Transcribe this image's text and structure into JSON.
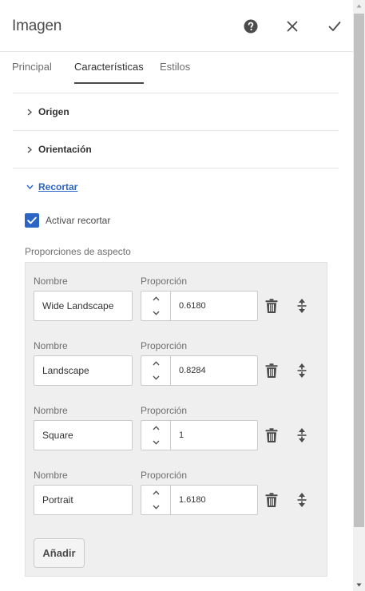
{
  "dialog": {
    "title": "Imagen",
    "help_icon": "help-circle-icon",
    "close_icon": "close-icon",
    "done_icon": "checkmark-icon"
  },
  "tabs": [
    {
      "label": "Principal",
      "active": false
    },
    {
      "label": "Características",
      "active": true
    },
    {
      "label": "Estilos",
      "active": false
    }
  ],
  "accordion": [
    {
      "label": "Origen",
      "expanded": false
    },
    {
      "label": "Orientación",
      "expanded": false
    },
    {
      "label": "Recortar",
      "expanded": true
    }
  ],
  "crop": {
    "enable_label": "Activar recortar",
    "enable_checked": true,
    "ratios_label": "Proporciones de aspecto",
    "name_label": "Nombre",
    "ratio_label": "Proporción",
    "rows": [
      {
        "name": "Wide Landscape",
        "ratio": "0.6180"
      },
      {
        "name": "Landscape",
        "ratio": "0.8284"
      },
      {
        "name": "Square",
        "ratio": "1"
      },
      {
        "name": "Portrait",
        "ratio": "1.6180"
      }
    ],
    "add_label": "Añadir"
  },
  "colors": {
    "accent": "#2b66c4",
    "text": "#323232",
    "multifield_bg": "#efefef"
  }
}
